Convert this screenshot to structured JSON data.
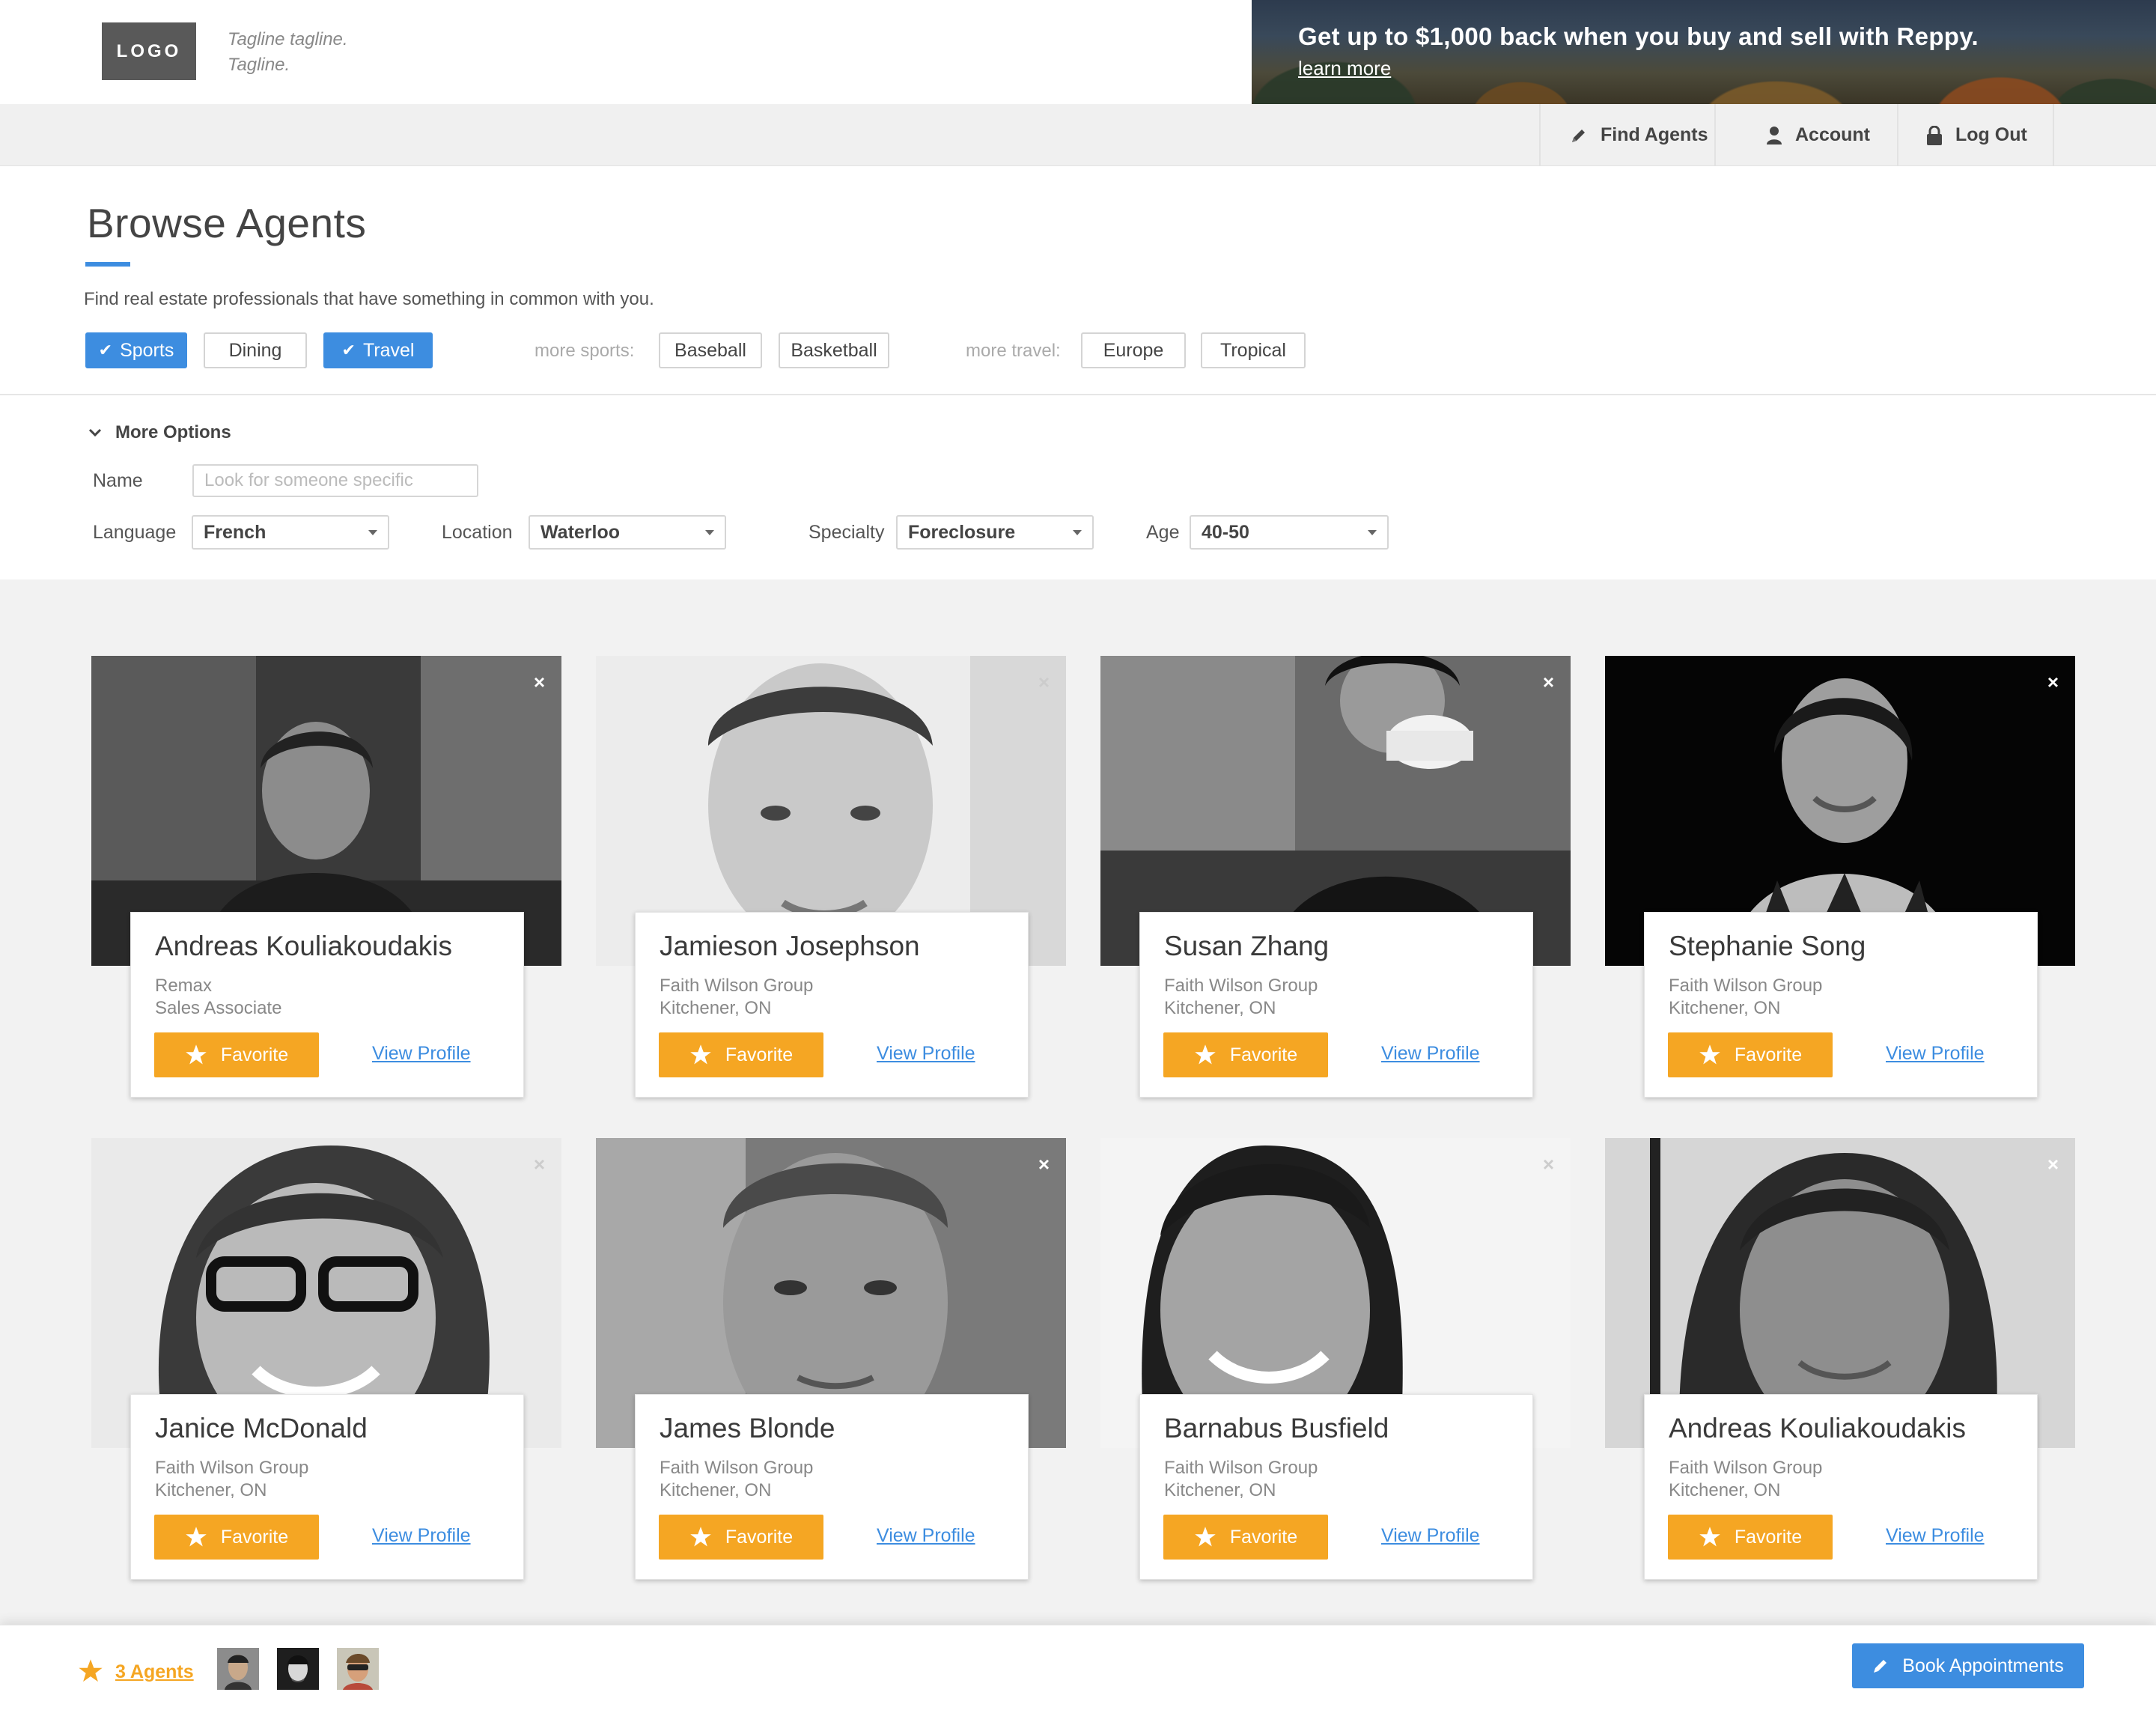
{
  "header": {
    "logo": "LOGO",
    "tagline_line1": "Tagline tagline.",
    "tagline_line2": "Tagline.",
    "promo_headline": "Get up to $1,000 back when you buy and sell with Reppy.",
    "promo_link": "learn more"
  },
  "nav": {
    "find_agents": "Find Agents",
    "account": "Account",
    "log_out": "Log Out"
  },
  "browse": {
    "title": "Browse Agents",
    "subtitle": "Find real estate professionals that have something in common with you.",
    "chips": [
      {
        "label": "Sports",
        "selected": true
      },
      {
        "label": "Dining",
        "selected": false
      },
      {
        "label": "Travel",
        "selected": true
      }
    ],
    "more_sports_label": "more sports:",
    "more_sports": [
      "Baseball",
      "Basketball"
    ],
    "more_travel_label": "more travel:",
    "more_travel": [
      "Europe",
      "Tropical"
    ]
  },
  "options": {
    "toggle": "More Options",
    "name_label": "Name",
    "name_placeholder": "Look for someone specific",
    "language_label": "Language",
    "language_value": "French",
    "location_label": "Location",
    "location_value": "Waterloo",
    "specialty_label": "Specialty",
    "specialty_value": "Foreclosure",
    "age_label": "Age",
    "age_value": "40-50"
  },
  "cards": [
    {
      "name": "Andreas Kouliakoudakis",
      "line1": "Remax",
      "line2": "Sales Associate",
      "favorite": "Favorite",
      "view": "View Profile",
      "close": "×"
    },
    {
      "name": "Jamieson Josephson",
      "line1": "Faith Wilson Group",
      "line2": "Kitchener, ON",
      "favorite": "Favorite",
      "view": "View Profile",
      "close": "×"
    },
    {
      "name": "Susan Zhang",
      "line1": "Faith Wilson Group",
      "line2": "Kitchener, ON",
      "favorite": "Favorite",
      "view": "View Profile",
      "close": "×"
    },
    {
      "name": "Stephanie Song",
      "line1": "Faith Wilson Group",
      "line2": "Kitchener, ON",
      "favorite": "Favorite",
      "view": "View Profile",
      "close": "×"
    },
    {
      "name": "Janice McDonald",
      "line1": "Faith Wilson Group",
      "line2": "Kitchener, ON",
      "favorite": "Favorite",
      "view": "View Profile",
      "close": "×"
    },
    {
      "name": "James Blonde",
      "line1": "Faith Wilson Group",
      "line2": "Kitchener, ON",
      "favorite": "Favorite",
      "view": "View Profile",
      "close": "×"
    },
    {
      "name": "Barnabus Busfield",
      "line1": "Faith Wilson Group",
      "line2": "Kitchener, ON",
      "favorite": "Favorite",
      "view": "View Profile",
      "close": "×"
    },
    {
      "name": "Andreas Kouliakoudakis",
      "line1": "Faith Wilson Group",
      "line2": "Kitchener, ON",
      "favorite": "Favorite",
      "view": "View Profile",
      "close": "×"
    }
  ],
  "footer": {
    "agents_count": "3 Agents",
    "book": "Book Appointments"
  },
  "colors": {
    "accent_blue": "#3d8de0",
    "favorite_orange": "#f5a623"
  },
  "icons": {
    "find_agents": "pencil-icon",
    "account": "user-icon",
    "log_out": "lock-icon",
    "favorite": "star-icon",
    "close": "close-icon",
    "toggle": "chevron-down-icon",
    "select": "caret-down-icon"
  }
}
